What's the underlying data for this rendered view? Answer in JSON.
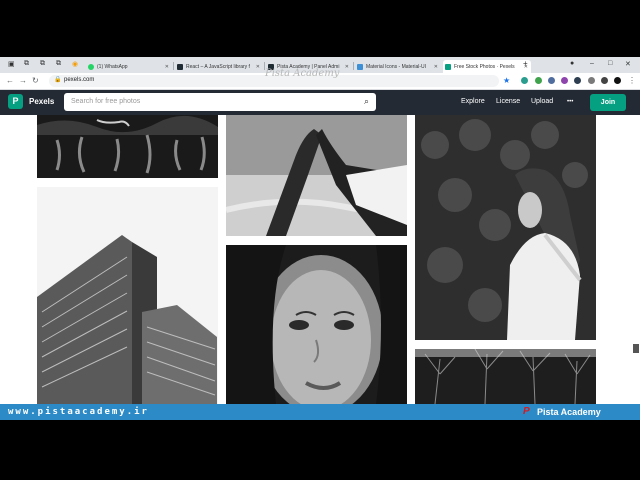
{
  "browser": {
    "tabs": [
      {
        "title": "(1) WhatsApp",
        "color": "#25d366"
      },
      {
        "title": "React – A JavaScript library f",
        "color": "#1f2b33"
      },
      {
        "title": "Pista Academy | Panel Admi",
        "color": "#1f2b33"
      },
      {
        "title": "Material Icons - Material-UI",
        "color": "#3d8fd6"
      },
      {
        "title": "Free Stock Photos · Pexels",
        "color": "#05a081"
      }
    ],
    "new_tab": "+",
    "url": "pexels.com",
    "watermark": "Pista Academy"
  },
  "pexels": {
    "logo_letter": "P",
    "name": "Pexels",
    "search_placeholder": "Search for free photos",
    "nav": {
      "explore": "Explore",
      "license": "License",
      "upload": "Upload",
      "more": "•••"
    },
    "join": "Join"
  },
  "photos": [
    {
      "description": "dark water reflection"
    },
    {
      "description": "two hands touching"
    },
    {
      "description": "woman by hedge"
    },
    {
      "description": "high-rise building"
    },
    {
      "description": "woman portrait close-up"
    },
    {
      "description": "bare trees"
    }
  ],
  "footer": {
    "site": "www.pistaacademy.ir",
    "brand": "Pista Academy"
  }
}
